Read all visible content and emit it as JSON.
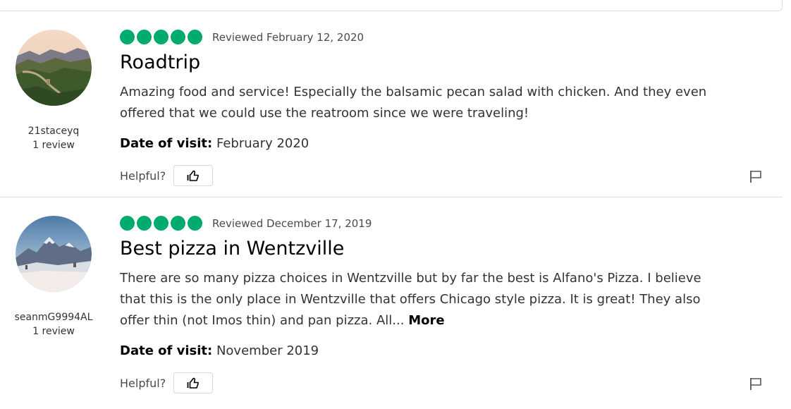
{
  "reviews": [
    {
      "author": {
        "name": "21staceyq",
        "count": "1 review",
        "avatar": "great-wall-landscape"
      },
      "rating": 5,
      "reviewed_date": "Reviewed February 12, 2020",
      "title": "Roadtrip",
      "body": "Amazing food and service! Especially the balsamic pecan salad with chicken. And they even offered that we could use the reatroom since we were traveling!",
      "more_label": "",
      "visit_label": "Date of visit:",
      "visit_value": " February 2020",
      "helpful_label": "Helpful?"
    },
    {
      "author": {
        "name": "seanmG9994AL",
        "count": "1 review",
        "avatar": "snowy-mountain-landscape"
      },
      "rating": 5,
      "reviewed_date": "Reviewed December 17, 2019",
      "title": "Best pizza in Wentzville",
      "body": "There are so many pizza choices in Wentzville but by far the best is Alfano's Pizza. I believe that this is the only place in Wentzville that offers Chicago style pizza. It is great! They also offer thin (not Imos thin) and pan pizza. All... ",
      "more_label": "More",
      "visit_label": "Date of visit:",
      "visit_value": " November 2019",
      "helpful_label": "Helpful?"
    }
  ],
  "icons": {
    "helpful": "thumbs-up-icon",
    "report": "flag-icon"
  },
  "colors": {
    "bubble": "#00aa6c",
    "divider": "#e0e0e0"
  }
}
